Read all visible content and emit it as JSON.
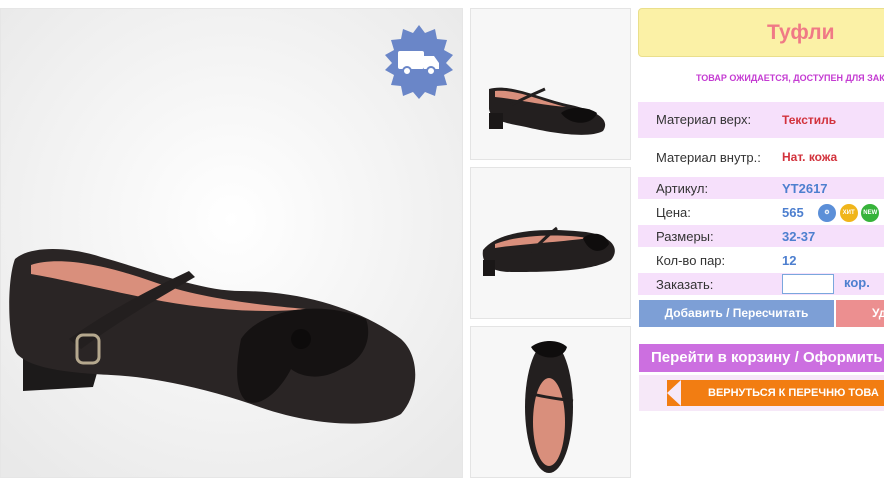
{
  "product": {
    "title": "Туфли",
    "status": "ТОВАР ОЖИДАЕТСЯ, ДОСТУПЕН ДЛЯ ЗАК"
  },
  "details": [
    {
      "label": "Материал верх:",
      "value": "Текстиль",
      "style": "red"
    },
    {
      "label": "Материал внутр.:",
      "value": "Нат. кожа",
      "style": "red"
    },
    {
      "label": "Артикул:",
      "value": "YT2617",
      "style": "blue"
    },
    {
      "label": "Цена:",
      "value": "565",
      "style": "blue"
    },
    {
      "label": "Размеры:",
      "value": "32-37",
      "style": "blue"
    },
    {
      "label": "Кол-во пар:",
      "value": "12",
      "style": "blue"
    }
  ],
  "order": {
    "label": "Заказать:",
    "value": "",
    "unit": "кор."
  },
  "badges": {
    "hit": "ХИТ",
    "new": "NEW"
  },
  "buttons": {
    "add": "Добавить / Пересчитать",
    "delete": "Уд",
    "cart": "Перейти в корзину / Оформить",
    "back": "ВЕРНУТЬСЯ К ПЕРЕЧНЮ ТОВА"
  },
  "colors": {
    "accent_pink": "#cc6fe0",
    "accent_blue": "#7d9fd6",
    "accent_orange": "#f27d12",
    "title_bg": "#fbf1a6"
  },
  "icons": {
    "delivery": "delivery-truck-icon"
  }
}
